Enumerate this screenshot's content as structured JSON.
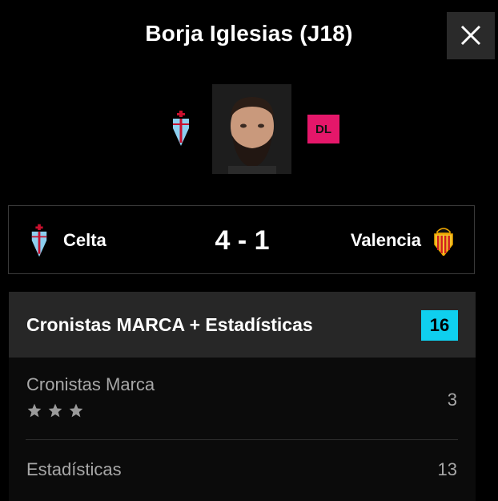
{
  "modal": {
    "title": "Borja Iglesias (J18)"
  },
  "player": {
    "position": "DL",
    "club_icon": "celta-crest-icon"
  },
  "match": {
    "home_team": "Celta",
    "away_team": "Valencia",
    "score": "4 - 1",
    "home_icon": "celta-crest-icon",
    "away_icon": "valencia-crest-icon"
  },
  "rating": {
    "title": "Cronistas MARCA + Estadísticas",
    "total": "16",
    "rows": [
      {
        "label": "Cronistas Marca",
        "value": "3",
        "stars": 3
      },
      {
        "label": "Estadísticas",
        "value": "13"
      }
    ]
  },
  "colors": {
    "position_badge": "#e5176a",
    "total_badge": "#0fcfee",
    "background": "#000000"
  }
}
